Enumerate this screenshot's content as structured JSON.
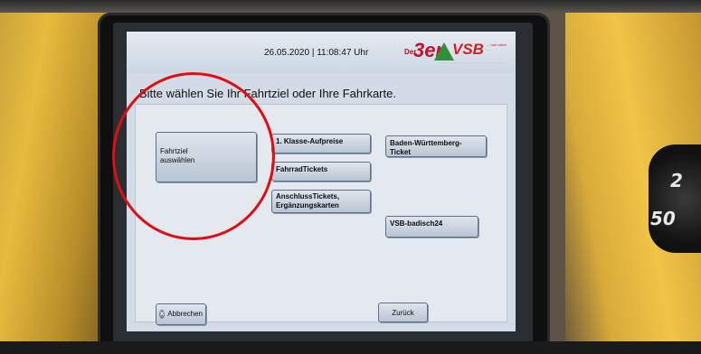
{
  "header": {
    "datetime": "26.05.2020 | 11:08:47 Uhr",
    "logo_3er": "3er",
    "logo_der": "Der",
    "logo_vsb": "VSB",
    "logo_vsb_small": "... nah dabei ..."
  },
  "heading": "Bitte wählen Sie Ihr Fahrtziel oder Ihre Fahrkarte.",
  "buttons": {
    "fahrtziel_line1": "Fahrtziel",
    "fahrtziel_line2": "auswählen",
    "klasse_aufpreis": "1. Klasse-Aufpreise",
    "fahrrad_tickets": "FahrradTickets",
    "anschluss_line1": "AnschlussTickets,",
    "anschluss_line2": "Ergänzungskarten",
    "baden_wuerttemberg": "Baden-Württemberg-Ticket",
    "vsb_badisch24": "VSB-badisch24",
    "abbrechen": "Abbrechen",
    "zurueck": "Zurück"
  },
  "machine": {
    "coin_label_top": "2",
    "coin_label_bottom": "50"
  },
  "colors": {
    "screen_bg": "#d2dbe6",
    "button_border": "#5e6f86",
    "annotation_red": "#e00e14",
    "machine_yellow": "#e6bb3e"
  }
}
